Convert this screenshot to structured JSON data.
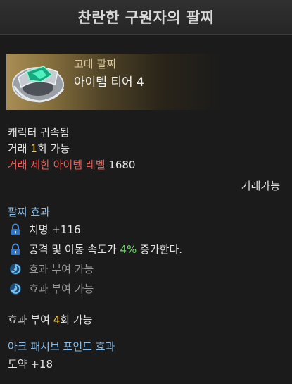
{
  "title": "찬란한 구원자의 팔찌",
  "item": {
    "grade": "고대 팔찌",
    "tier": "아이템 티어 4"
  },
  "binding": "캐릭터 귀속됨",
  "trade_count": {
    "prefix": "거래 ",
    "count": "1",
    "suffix": "회 가능"
  },
  "level_limit": {
    "label": "거래 제한 아이템 레벨",
    "value": "1680"
  },
  "tradeable": "거래가능",
  "bracelet_effects": {
    "header": "팔찌 효과",
    "stats": [
      {
        "icon": "lock-icon",
        "text": "치명 +116"
      },
      {
        "icon": "lock-icon",
        "prefix": "공격 및 이동 속도가 ",
        "highlight": "4%",
        "suffix": " 증가한다."
      }
    ],
    "slots": [
      {
        "icon": "swirl-icon",
        "text": "효과 부여 가능"
      },
      {
        "icon": "swirl-icon",
        "text": "효과 부여 가능"
      }
    ]
  },
  "grant_count": {
    "prefix": "효과 부여 ",
    "count": "4",
    "suffix": "회 가능"
  },
  "ark_passive": {
    "header": "아크 패시브 포인트 효과",
    "value": "도약 +18"
  },
  "colors": {
    "background": "#1b1b1b",
    "title_bar": "#2b2b2b",
    "red": "#e0605a",
    "yellow": "#f2cc3a",
    "green": "#6fd56c",
    "blue_header": "#8bbde6",
    "ancient_gold": "#a88e55"
  }
}
